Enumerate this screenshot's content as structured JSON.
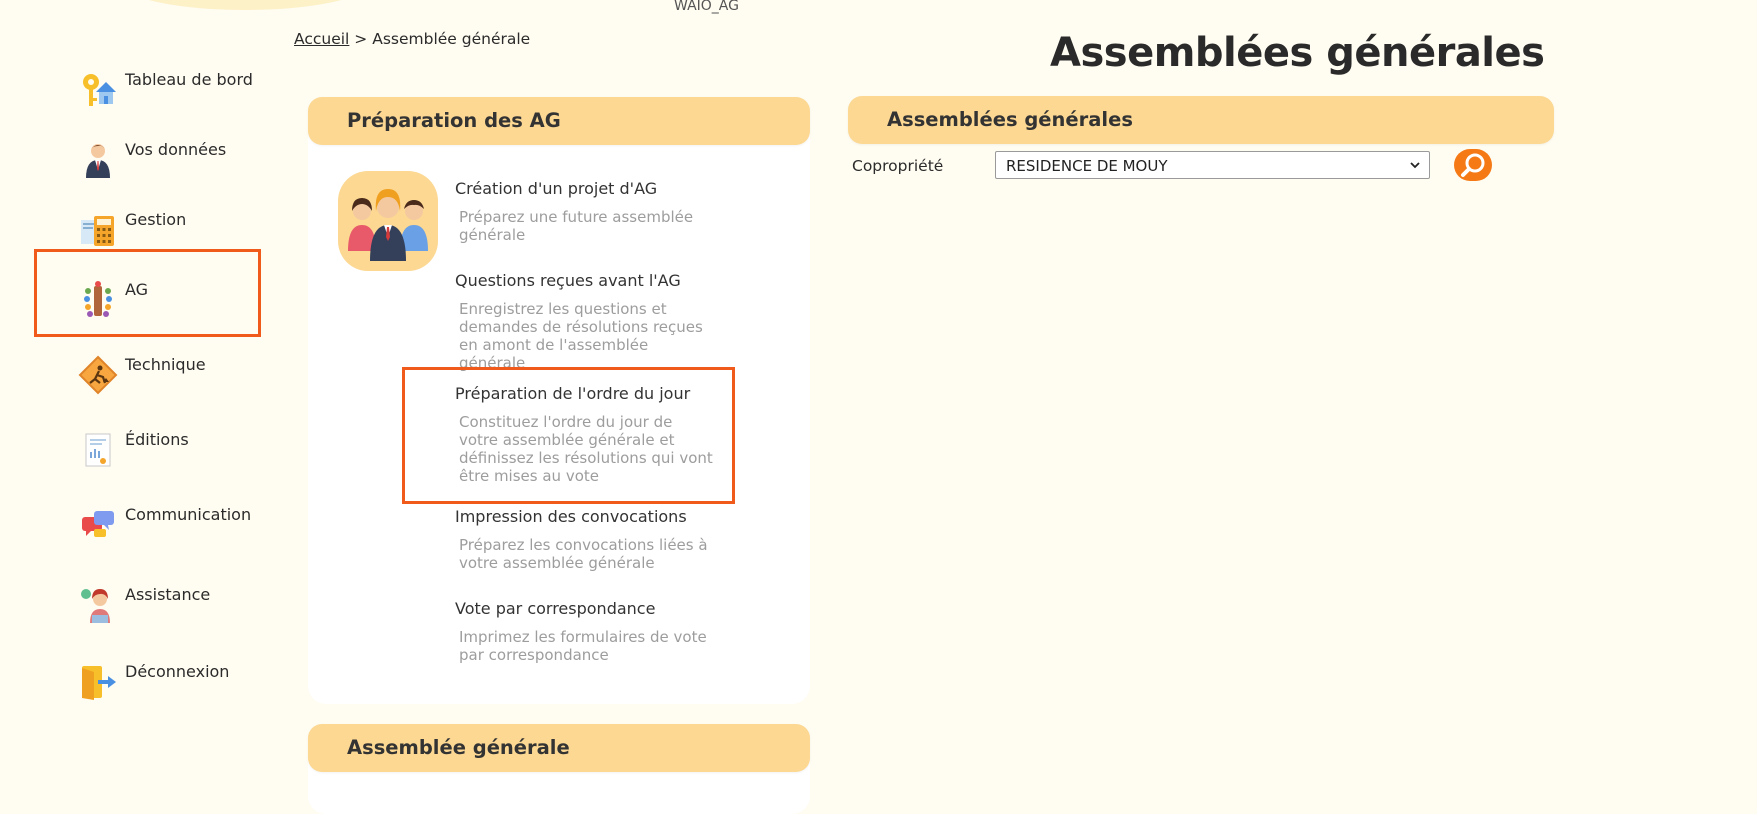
{
  "app_code": "WAIO_AG",
  "breadcrumb": {
    "home": "Accueil",
    "separator": ">",
    "current": "Assemblée générale"
  },
  "page_title": "Assemblées générales",
  "sidebar": {
    "items": [
      {
        "label": "Tableau de bord",
        "icon": "dashboard-key-house-icon"
      },
      {
        "label": "Vos données",
        "icon": "person-icon"
      },
      {
        "label": "Gestion",
        "icon": "calculator-icon"
      },
      {
        "label": "AG",
        "icon": "meeting-table-icon",
        "active": true
      },
      {
        "label": "Technique",
        "icon": "worker-sign-icon"
      },
      {
        "label": "Éditions",
        "icon": "report-document-icon"
      },
      {
        "label": "Communication",
        "icon": "chat-bubbles-icon"
      },
      {
        "label": "Assistance",
        "icon": "support-agent-icon"
      },
      {
        "label": "Déconnexion",
        "icon": "logout-door-icon"
      }
    ]
  },
  "prep_card": {
    "title": "Préparation des AG",
    "avatar_icon": "group-people-icon",
    "entries": [
      {
        "title": "Création d'un projet d'AG",
        "description": "Préparez une future assemblée générale"
      },
      {
        "title": "Questions reçues avant l'AG",
        "description": "Enregistrez les questions et demandes de résolutions reçues en amont de l'assemblée générale"
      },
      {
        "title": "Préparation de l'ordre du jour",
        "description": "Constituez l'ordre du jour de votre assemblée générale et définissez les résolutions qui vont être mises au vote"
      },
      {
        "title": "Impression des convocations",
        "description": "Préparez les convocations liées à votre assemblée générale"
      },
      {
        "title": "Vote par correspondance",
        "description": "Imprimez les formulaires de vote par correspondance"
      }
    ]
  },
  "ag_card": {
    "title": "Assemblée générale"
  },
  "search_card": {
    "title": "Assemblées générales",
    "field_label": "Copropriété",
    "selected_value": "RESIDENCE DE MOUY",
    "search_icon": "magnifier-icon"
  },
  "colors": {
    "accent": "#f05a1a",
    "header_bg": "#fcd893",
    "page_bg": "#fffcf1",
    "button": "#f57a16"
  }
}
